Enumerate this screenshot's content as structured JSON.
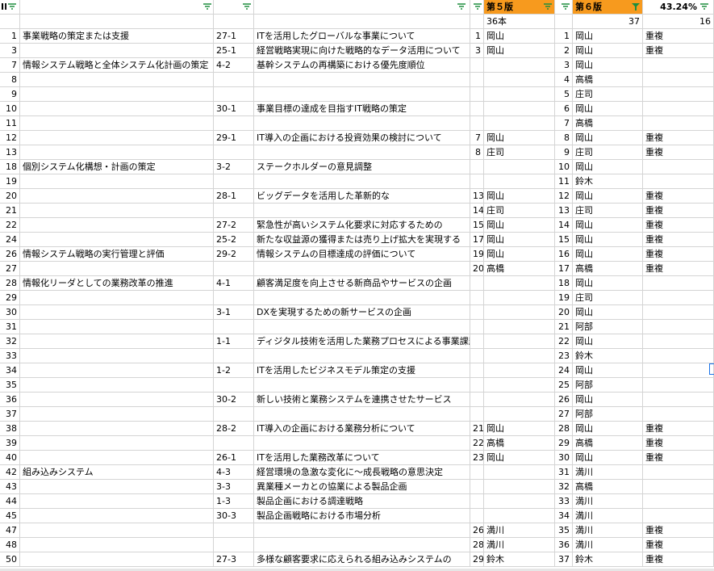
{
  "header": {
    "col_a": "ID",
    "col_f": "第５版",
    "col_h": "第６版",
    "col_i": "43.24%",
    "colors": {
      "orange": "#f79a1e",
      "filter_green": "#1e8e3e",
      "grid": "#d4d4d4"
    },
    "filter_icons": [
      "filter-icon",
      "filter-active-icon"
    ]
  },
  "summary": {
    "f": "36本",
    "h": "37",
    "i": "16"
  },
  "rows": [
    {
      "a": "1",
      "b": "事業戦略の策定または支援",
      "c": "27-1",
      "d": "ITを活用したグローバルな事業について",
      "e": "1",
      "f": "岡山",
      "g": "1",
      "h": "岡山",
      "i": "重複"
    },
    {
      "a": "3",
      "b": "",
      "c": "25-1",
      "d": "経営戦略実現に向けた戦略的なデータ活用について",
      "e": "3",
      "f": "岡山",
      "g": "2",
      "h": "岡山",
      "i": "重複"
    },
    {
      "a": "7",
      "b": "情報システム戦略と全体システム化計画の策定",
      "c": "4-2",
      "d": "基幹システムの再構築における優先度順位",
      "e": "",
      "f": "",
      "g": "3",
      "h": "岡山",
      "i": ""
    },
    {
      "a": "8",
      "b": "",
      "c": "",
      "d": "",
      "e": "",
      "f": "",
      "g": "4",
      "h": "高橋",
      "i": ""
    },
    {
      "a": "9",
      "b": "",
      "c": "",
      "d": "",
      "e": "",
      "f": "",
      "g": "5",
      "h": "庄司",
      "i": ""
    },
    {
      "a": "10",
      "b": "",
      "c": "30-1",
      "d": "事業目標の達成を目指すIT戦略の策定",
      "e": "",
      "f": "",
      "g": "6",
      "h": "岡山",
      "i": ""
    },
    {
      "a": "11",
      "b": "",
      "c": "",
      "d": "",
      "e": "",
      "f": "",
      "g": "7",
      "h": "高橋",
      "i": ""
    },
    {
      "a": "12",
      "b": "",
      "c": "29-1",
      "d": "IT導入の企画における投資効果の検討について",
      "e": "7",
      "f": "岡山",
      "g": "8",
      "h": "岡山",
      "i": "重複"
    },
    {
      "a": "13",
      "b": "",
      "c": "",
      "d": "",
      "e": "8",
      "f": "庄司",
      "g": "9",
      "h": "庄司",
      "i": "重複"
    },
    {
      "a": "18",
      "b": "個別システム化構想・計画の策定",
      "c": "3-2",
      "d": "ステークホルダーの意見調整",
      "e": "",
      "f": "",
      "g": "10",
      "h": "岡山",
      "i": ""
    },
    {
      "a": "19",
      "b": "",
      "c": "",
      "d": "",
      "e": "",
      "f": "",
      "g": "11",
      "h": "鈴木",
      "i": ""
    },
    {
      "a": "20",
      "b": "",
      "c": "28-1",
      "d": "ビッグデータを活用した革新的な",
      "e": "13",
      "f": "岡山",
      "g": "12",
      "h": "岡山",
      "i": "重複"
    },
    {
      "a": "21",
      "b": "",
      "c": "",
      "d": "",
      "e": "14",
      "f": "庄司",
      "g": "13",
      "h": "庄司",
      "i": "重複"
    },
    {
      "a": "22",
      "b": "",
      "c": "27-2",
      "d": "緊急性が高いシステム化要求に対応するための",
      "e": "15",
      "f": "岡山",
      "g": "14",
      "h": "岡山",
      "i": "重複"
    },
    {
      "a": "24",
      "b": "",
      "c": "25-2",
      "d": "新たな収益源の獲得または売り上げ拡大を実現する",
      "e": "17",
      "f": "岡山",
      "g": "15",
      "h": "岡山",
      "i": "重複"
    },
    {
      "a": "26",
      "b": "情報システム戦略の実行管理と評価",
      "c": "29-2",
      "d": "情報システムの目標達成の評価について",
      "e": "19",
      "f": "岡山",
      "g": "16",
      "h": "岡山",
      "i": "重複"
    },
    {
      "a": "27",
      "b": "",
      "c": "",
      "d": "",
      "e": "20",
      "f": "高橋",
      "g": "17",
      "h": "高橋",
      "i": "重複"
    },
    {
      "a": "28",
      "b": "情報化リーダとしての業務改革の推進",
      "c": "4-1",
      "d": "顧客満足度を向上させる新商品やサービスの企画",
      "e": "",
      "f": "",
      "g": "18",
      "h": "岡山",
      "i": ""
    },
    {
      "a": "29",
      "b": "",
      "c": "",
      "d": "",
      "e": "",
      "f": "",
      "g": "19",
      "h": "庄司",
      "i": ""
    },
    {
      "a": "30",
      "b": "",
      "c": "3-1",
      "d": "DXを実現するための新サービスの企画",
      "e": "",
      "f": "",
      "g": "20",
      "h": "岡山",
      "i": ""
    },
    {
      "a": "31",
      "b": "",
      "c": "",
      "d": "",
      "e": "",
      "f": "",
      "g": "21",
      "h": "阿部",
      "i": ""
    },
    {
      "a": "32",
      "b": "",
      "c": "1-1",
      "d": "ディジタル技術を活用した業務プロセスによる事業課題の",
      "e": "",
      "f": "",
      "g": "22",
      "h": "岡山",
      "i": ""
    },
    {
      "a": "33",
      "b": "",
      "c": "",
      "d": "",
      "e": "",
      "f": "",
      "g": "23",
      "h": "鈴木",
      "i": ""
    },
    {
      "a": "34",
      "b": "",
      "c": "1-2",
      "d": "ITを活用したビジネスモデル策定の支援",
      "e": "",
      "f": "",
      "g": "24",
      "h": "岡山",
      "i": ""
    },
    {
      "a": "35",
      "b": "",
      "c": "",
      "d": "",
      "e": "",
      "f": "",
      "g": "25",
      "h": "阿部",
      "i": ""
    },
    {
      "a": "36",
      "b": "",
      "c": "30-2",
      "d": "新しい技術と業務システムを連携させたサービス",
      "e": "",
      "f": "",
      "g": "26",
      "h": "岡山",
      "i": ""
    },
    {
      "a": "37",
      "b": "",
      "c": "",
      "d": "",
      "e": "",
      "f": "",
      "g": "27",
      "h": "阿部",
      "i": ""
    },
    {
      "a": "38",
      "b": "",
      "c": "28-2",
      "d": "IT導入の企画における業務分析について",
      "e": "21",
      "f": "岡山",
      "g": "28",
      "h": "岡山",
      "i": "重複"
    },
    {
      "a": "39",
      "b": "",
      "c": "",
      "d": "",
      "e": "22",
      "f": "高橋",
      "g": "29",
      "h": "高橋",
      "i": "重複"
    },
    {
      "a": "40",
      "b": "",
      "c": "26-1",
      "d": "ITを活用した業務改革について",
      "e": "23",
      "f": "岡山",
      "g": "30",
      "h": "岡山",
      "i": "重複"
    },
    {
      "a": "42",
      "b": "組み込みシステム",
      "c": "4-3",
      "d": "経営環境の急激な変化に～成長戦略の意思決定",
      "e": "",
      "f": "",
      "g": "31",
      "h": "満川",
      "i": ""
    },
    {
      "a": "43",
      "b": "",
      "c": "3-3",
      "d": "異業種メーカとの協業による製品企画",
      "e": "",
      "f": "",
      "g": "32",
      "h": "高橋",
      "i": ""
    },
    {
      "a": "44",
      "b": "",
      "c": "1-3",
      "d": "製品企画における調達戦略",
      "e": "",
      "f": "",
      "g": "33",
      "h": "満川",
      "i": ""
    },
    {
      "a": "45",
      "b": "",
      "c": "30-3",
      "d": "製品企画戦略における市場分析",
      "e": "",
      "f": "",
      "g": "34",
      "h": "満川",
      "i": ""
    },
    {
      "a": "47",
      "b": "",
      "c": "",
      "d": "",
      "e": "26",
      "f": "満川",
      "g": "35",
      "h": "満川",
      "i": "重複"
    },
    {
      "a": "48",
      "b": "",
      "c": "",
      "d": "",
      "e": "28",
      "f": "満川",
      "g": "36",
      "h": "満川",
      "i": "重複"
    },
    {
      "a": "50",
      "b": "",
      "c": "27-3",
      "d": "多様な顧客要求に応えられる組み込みシステムの",
      "e": "29",
      "f": "鈴木",
      "g": "37",
      "h": "鈴木",
      "i": "重複"
    }
  ]
}
